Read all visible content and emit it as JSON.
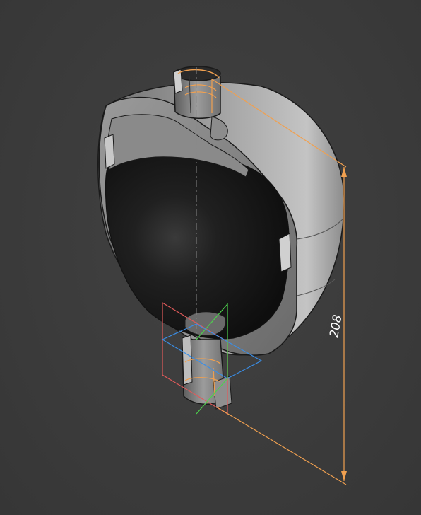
{
  "viewport": {
    "background_color": "#3c3c3c"
  },
  "model": {
    "kind": "section-view",
    "shell_color": "#9a9a9a",
    "cavity_color": "#151515",
    "edge_color": "#1a1a1a"
  },
  "dimension": {
    "value": "208",
    "line_color": "#f0a050"
  },
  "triad": {
    "x_axis_color": "#3a8ee6",
    "y_axis_color": "#4cd24c",
    "plane_color": "#e05a5a"
  }
}
